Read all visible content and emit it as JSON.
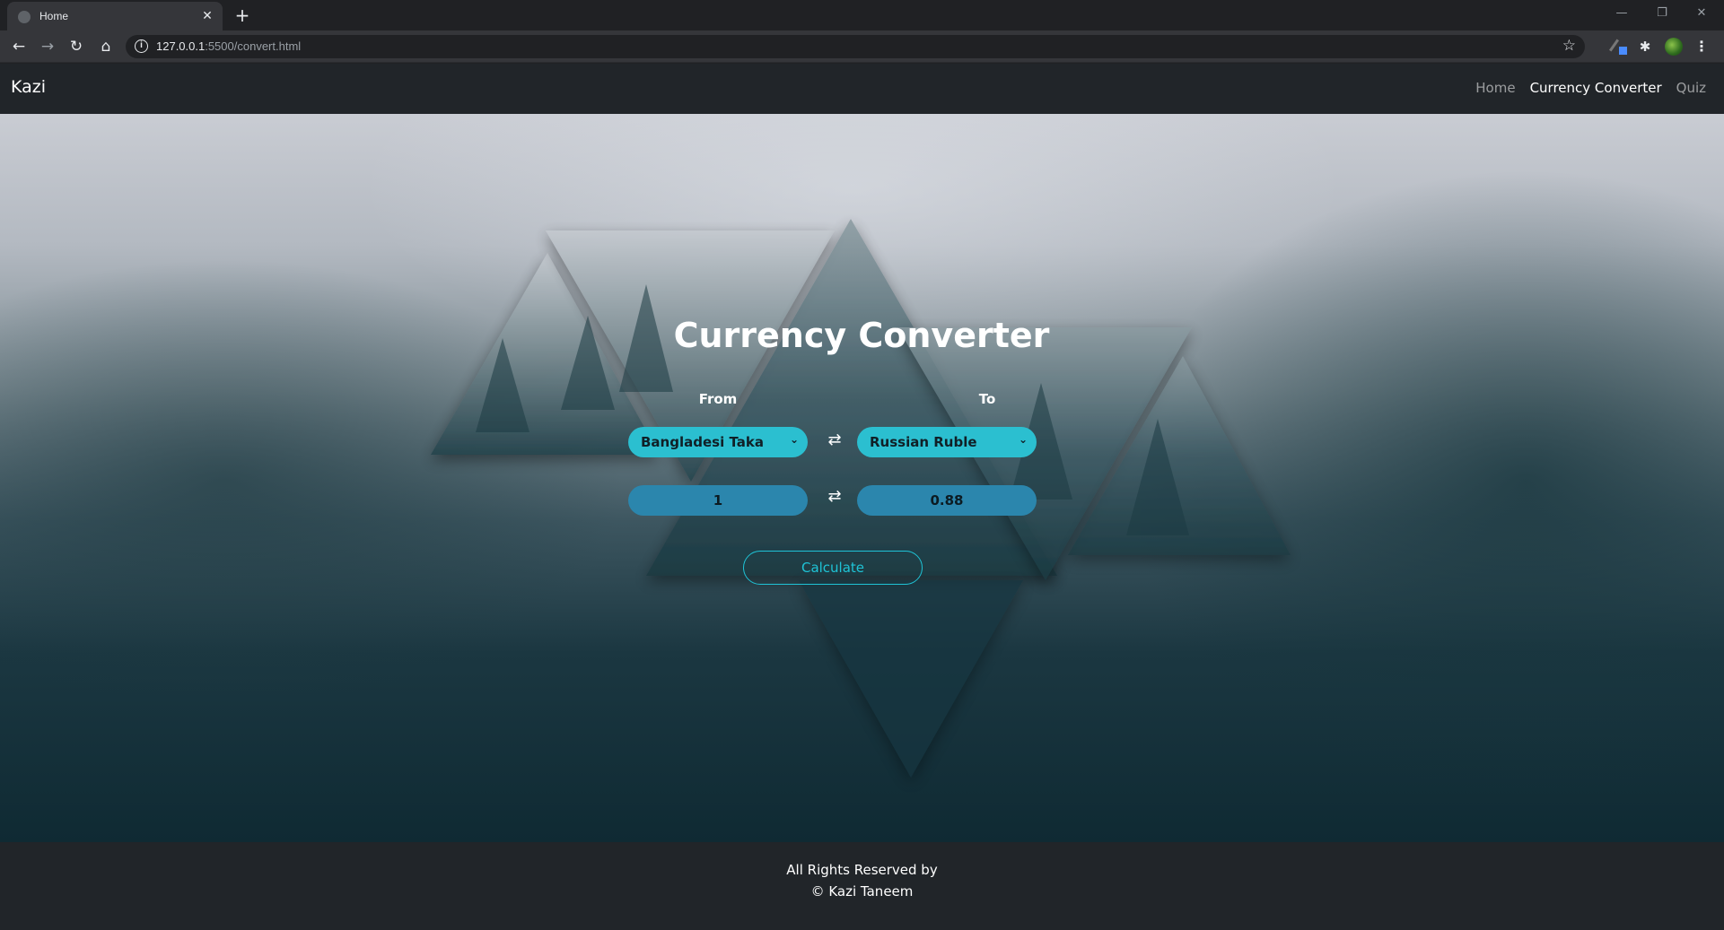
{
  "browser": {
    "tab_title": "Home",
    "tab_close": "✕",
    "new_tab": "+",
    "window_controls": {
      "minimize": "—",
      "restore": "❐",
      "close": "✕"
    },
    "nav": {
      "back": "←",
      "forward": "→",
      "reload": "↻",
      "home": "⌂"
    },
    "url_host": "127.0.0.1",
    "url_path": ":5500/convert.html",
    "info_icon": "i",
    "star": "☆",
    "extensions": {
      "puzzle": "✱",
      "menu": "⋮"
    }
  },
  "site": {
    "brand": "Kazi",
    "nav_links": [
      {
        "label": "Home",
        "active": false
      },
      {
        "label": "Currency Converter",
        "active": true
      },
      {
        "label": "Quiz",
        "active": false
      }
    ]
  },
  "converter": {
    "title": "Currency Converter",
    "from_label": "From",
    "to_label": "To",
    "from_currency": "Bangladesi Taka",
    "to_currency": "Russian Ruble",
    "swap_icon": "⇄",
    "chevron": "⌄",
    "from_amount": "1",
    "to_amount": "0.88",
    "calculate_label": "Calculate"
  },
  "footer": {
    "line1": "All Rights Reserved by",
    "line2": "© Kazi Taneem"
  },
  "colors": {
    "navbar": "#212529",
    "select_bg": "#2bbfd0",
    "amount_bg": "#2b86ad",
    "accent": "#1fc3d6"
  }
}
